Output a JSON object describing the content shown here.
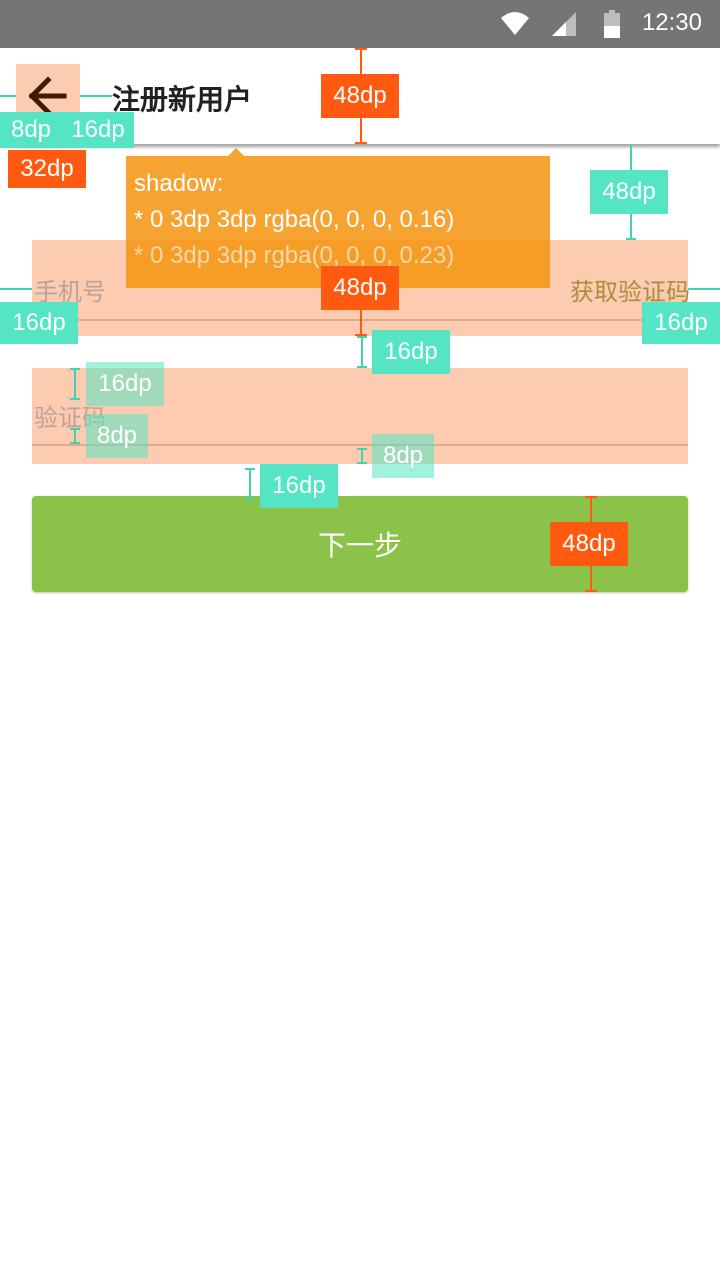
{
  "status_bar": {
    "time": "12:30",
    "icons": [
      "wifi-icon",
      "cell-signal-icon",
      "battery-icon"
    ]
  },
  "toolbar": {
    "title": "注册新用户",
    "back_icon": "arrow-back-icon"
  },
  "form": {
    "phone_placeholder": "手机号",
    "get_code_label": "获取验证码",
    "code_placeholder": "验证码",
    "next_label": "下一步"
  },
  "annotations": {
    "shadow_title": "shadow:",
    "shadow_line1": "* 0 3dp 3dp rgba(0, 0, 0, 0.16)",
    "shadow_line2": "* 0 3dp 3dp rgba(0, 0, 0, 0.23)",
    "dp8": "8dp",
    "dp16": "16dp",
    "dp32": "32dp",
    "dp48": "48dp"
  },
  "colors": {
    "status_bar": "#757575",
    "accent_button": "#8bc34a",
    "spec_teal": "#56e5c4",
    "spec_orange": "#ff5a10",
    "field_highlight": "#fdcbb0"
  }
}
